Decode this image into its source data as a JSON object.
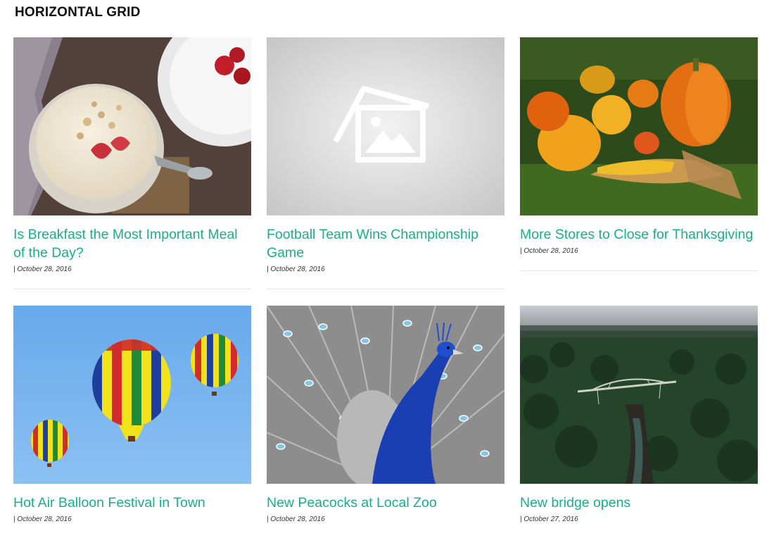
{
  "section": {
    "title": "HORIZONTAL GRID"
  },
  "posts": [
    {
      "title": "Is Breakfast the Most Important Meal of the Day?",
      "meta": "| October 28, 2016",
      "image": "yogurt-breakfast-photo"
    },
    {
      "title": "Football Team Wins Championship Game",
      "meta": "| October 28, 2016",
      "image": "placeholder-image"
    },
    {
      "title": "More Stores to Close for Thanksgiving",
      "meta": "| October 28, 2016",
      "image": "pumpkins-photo"
    },
    {
      "title": "Hot Air Balloon Festival in Town",
      "meta": "| October 28, 2016",
      "image": "hot-air-balloons-photo"
    },
    {
      "title": "New Peacocks at Local Zoo",
      "meta": "| October 28, 2016",
      "image": "peacock-photo"
    },
    {
      "title": "New bridge opens",
      "meta": "| October 27, 2016",
      "image": "bridge-forest-photo"
    }
  ],
  "colors": {
    "accent": "#16b08b",
    "divider": "#e6e6e6",
    "title": "#111111"
  }
}
